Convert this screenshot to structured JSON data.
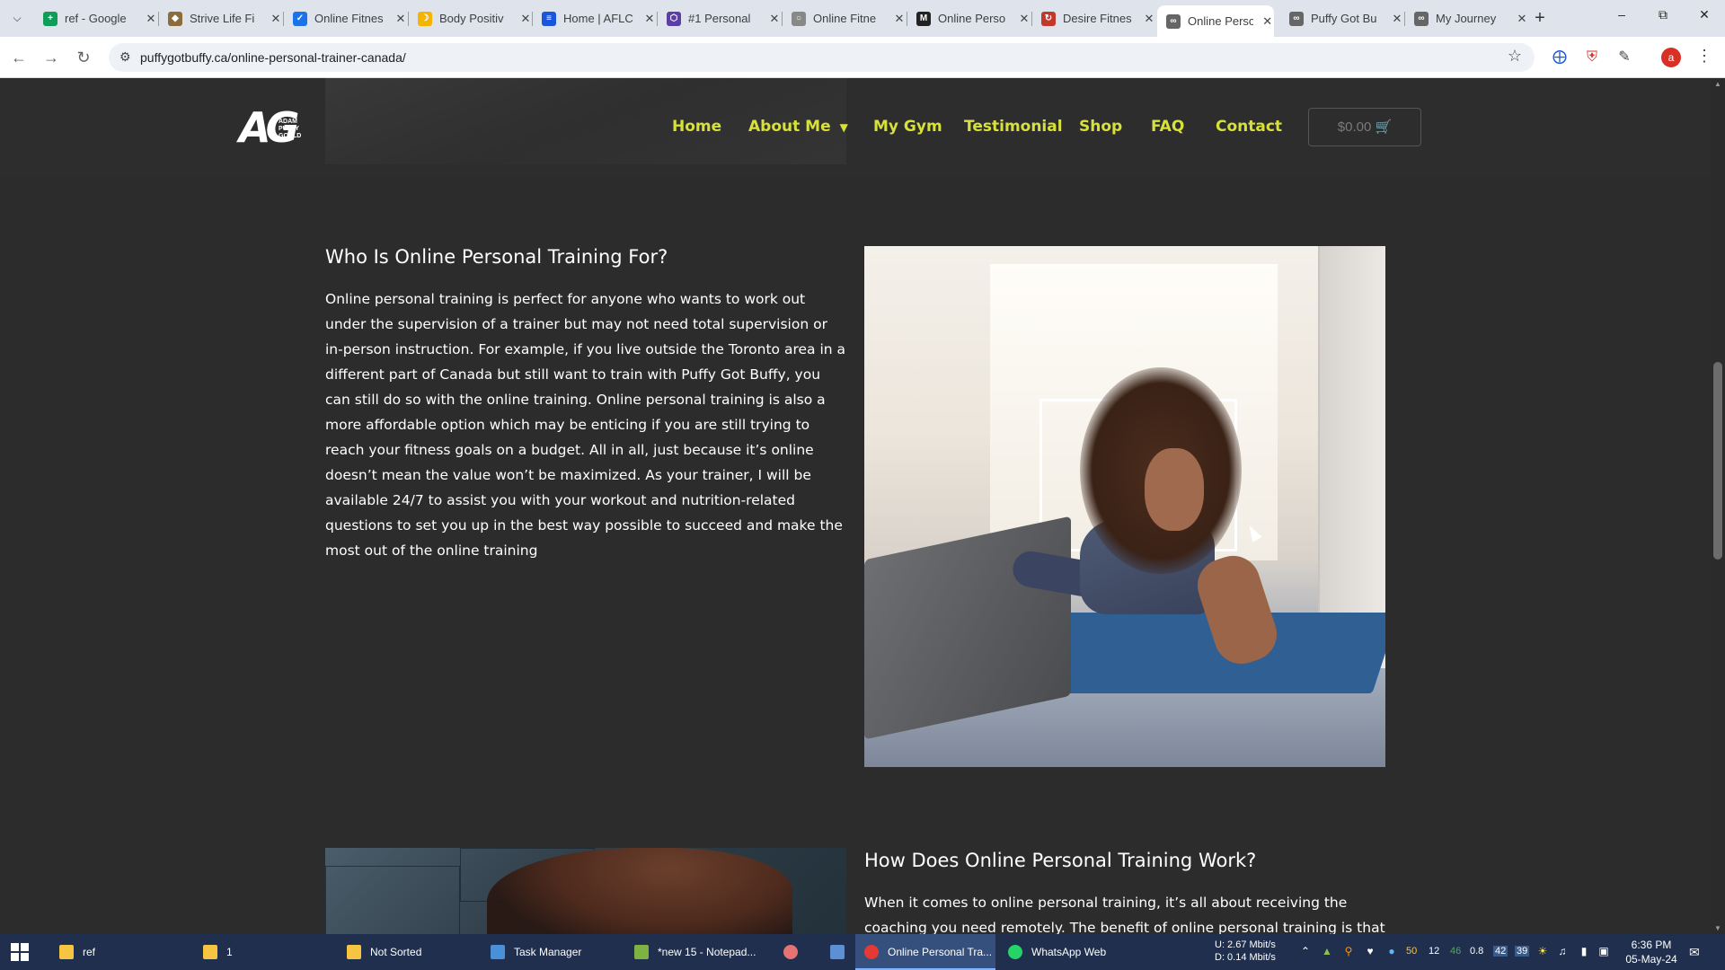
{
  "browser": {
    "tabs": [
      {
        "title": "ref - Google",
        "icon": "sheets-icon",
        "color": "#0f9d58"
      },
      {
        "title": "Strive Life Fi",
        "icon": "shield-icon",
        "color": "#8a6d3b"
      },
      {
        "title": "Online Fitnes",
        "icon": "check-icon",
        "color": "#1a73e8"
      },
      {
        "title": "Body Positiv",
        "icon": "moon-icon",
        "color": "#f4b400"
      },
      {
        "title": "Home | AFLC",
        "icon": "list-icon",
        "color": "#1a56db"
      },
      {
        "title": "#1 Personal",
        "icon": "hexagon-icon",
        "color": "#5b3ea6"
      },
      {
        "title": "Online Fitne",
        "icon": "circle-icon",
        "color": "#888888"
      },
      {
        "title": "Online Perso",
        "icon": "m-icon",
        "color": "#222222"
      },
      {
        "title": "Desire Fitnes",
        "icon": "loading-icon",
        "color": "#c0392b"
      },
      {
        "title": "Online Perso",
        "icon": "runner-icon",
        "color": "#666666",
        "active": true
      },
      {
        "title": "Puffy Got Bu",
        "icon": "runner-icon",
        "color": "#666666"
      },
      {
        "title": "My Journey",
        "icon": "runner-icon",
        "color": "#666666"
      }
    ],
    "url": "puffygotbuffy.ca/online-personal-trainer-canada/",
    "profile_initial": "a"
  },
  "site": {
    "logo_text": "AG",
    "logo_sub": [
      "ADAM",
      "PUFFY",
      "GOULD"
    ],
    "nav": [
      "Home",
      "About Me",
      "My Gym",
      "Testimonial",
      "Shop",
      "FAQ",
      "Contact"
    ],
    "cart": "$0.00",
    "accent": "#d8e03a"
  },
  "section1": {
    "title": "Who Is Online Personal Training For?",
    "body": "Online personal training is perfect for anyone who wants to work out under the supervision of a trainer but may not need total supervision or in-person instruction. For example, if you live outside the Toronto area in a different part of Canada but still want to train with Puffy Got Buffy, you can still do so with the online training. Online personal training is also a more affordable option which may be enticing if you are still trying to reach your fitness goals on a budget. All in all, just because it’s online doesn’t mean the value won’t be maximized. As your trainer, I will be available 24/7 to assist you with your workout and nutrition-related questions to set you up in the best way possible to succeed and make the most out of the online training"
  },
  "section2": {
    "title": "How Does Online Personal Training Work?",
    "body": "When it comes to online personal training, it’s all about receiving the coaching you need remotely. The benefit of online personal training is that"
  },
  "taskbar": {
    "items": [
      {
        "label": "ref",
        "icon": "folder-icon"
      },
      {
        "label": "1",
        "icon": "folder-icon"
      },
      {
        "label": "Not Sorted",
        "icon": "folder-icon"
      },
      {
        "label": "Task Manager",
        "icon": "task-manager-icon"
      },
      {
        "label": "*new 15 - Notepad...",
        "icon": "notepad-icon"
      },
      {
        "label": "",
        "icon": "app-icon"
      },
      {
        "label": "",
        "icon": "document-icon"
      },
      {
        "label": "Online Personal Tra...",
        "icon": "chrome-icon",
        "active": true
      },
      {
        "label": "WhatsApp Web",
        "icon": "whatsapp-icon"
      }
    ],
    "net_up": "U:   2.67 Mbit/s",
    "net_down": "D:   0.14 Mbit/s",
    "tray_numbers": [
      "50",
      "12",
      "46",
      "0.8",
      "42",
      "39"
    ],
    "time": "6:36 PM",
    "date": "05-May-24"
  }
}
